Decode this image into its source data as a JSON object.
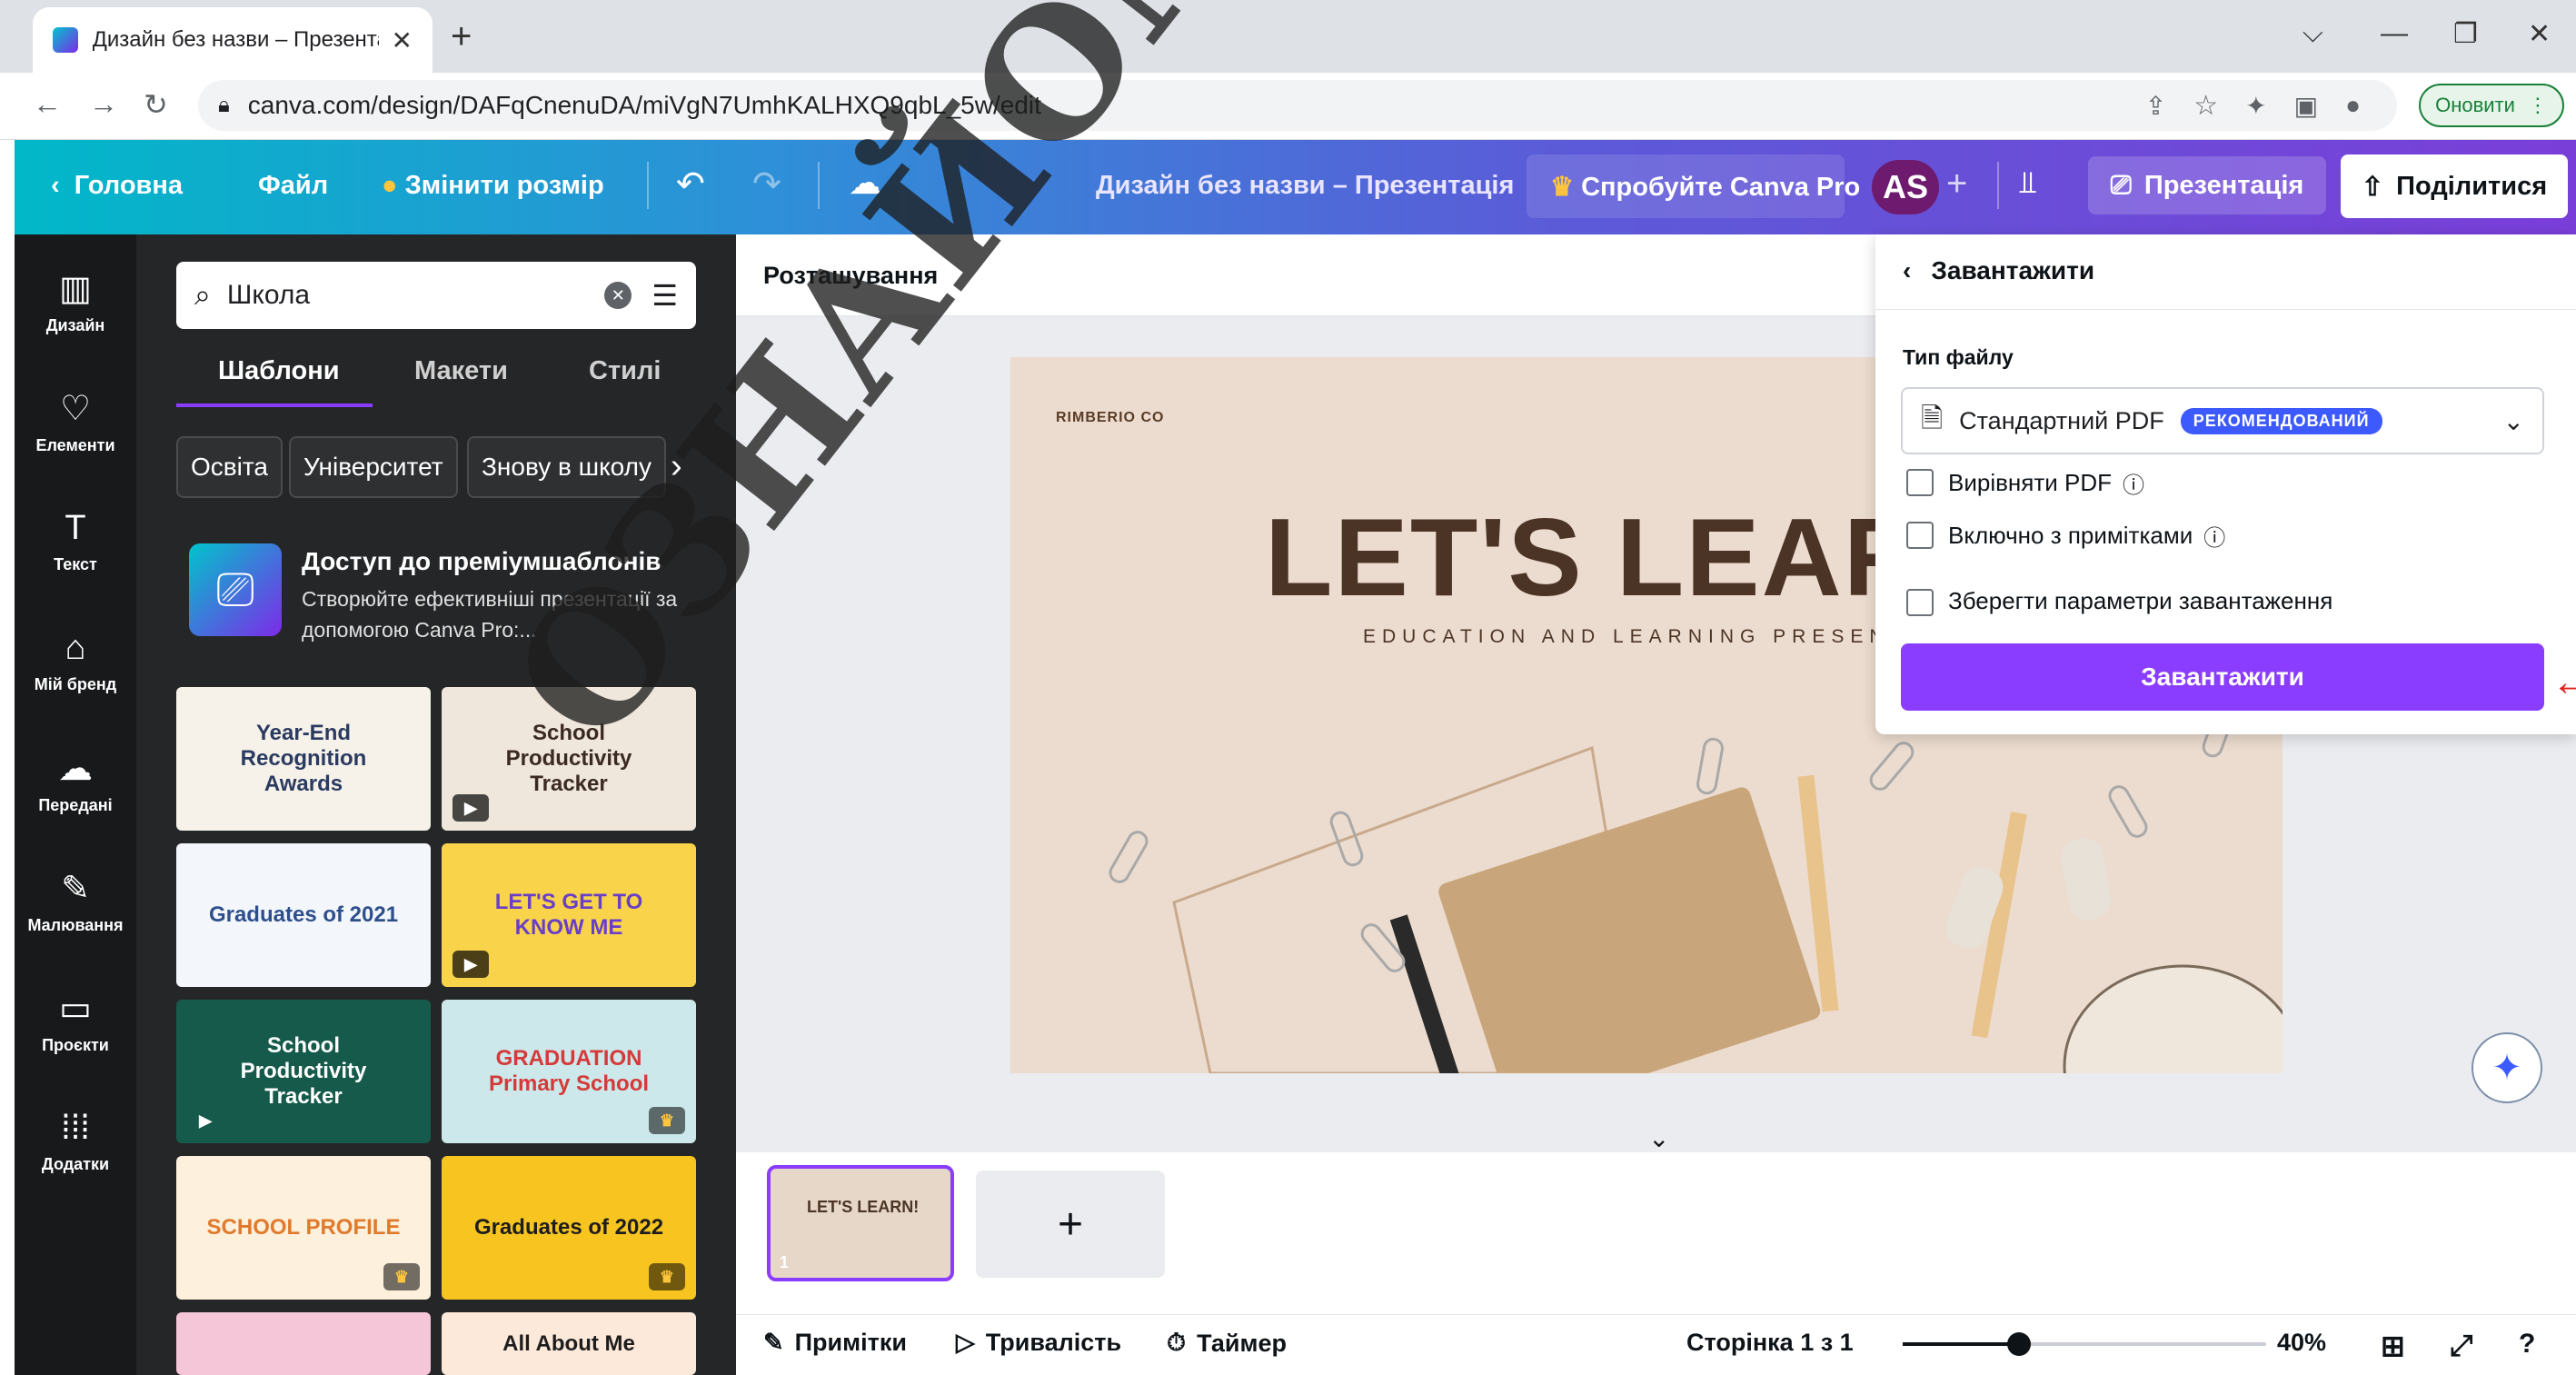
{
  "browser": {
    "tab_title": "Дизайн без назви – Презентаці",
    "tab_close": "✕",
    "new_tab": "+",
    "url": "canva.com/design/DAFqCnenuDA/miVgN7UmhKALHXQ9qbL_5w/edit",
    "update_label": "Оновити"
  },
  "header": {
    "home": "Головна",
    "file": "Файл",
    "resize": "Змінити розмір",
    "doc_title": "Дизайн без назви – Презентація",
    "try_pro": "Спробуйте Canva Pro",
    "avatar": "AS",
    "present": "Презентація",
    "share": "Поділитися"
  },
  "rail": {
    "items": [
      {
        "label": "Дизайн",
        "icon": "▥"
      },
      {
        "label": "Елементи",
        "icon": "♡"
      },
      {
        "label": "Текст",
        "icon": "T"
      },
      {
        "label": "Мій бренд",
        "icon": "⌂"
      },
      {
        "label": "Передані",
        "icon": "☁"
      },
      {
        "label": "Малювання",
        "icon": "✎"
      },
      {
        "label": "Проєкти",
        "icon": "▭"
      },
      {
        "label": "Додатки",
        "icon": "⁞⁞⁞"
      }
    ]
  },
  "panel": {
    "search_value": "Школа",
    "tabs": [
      "Шаблони",
      "Макети",
      "Стилі"
    ],
    "chips": [
      "Освіта",
      "Університет",
      "Знову в школу"
    ],
    "promo_title": "Доступ до преміумшаблонів",
    "promo_desc": "Створюйте ефективніші презентації за допомогою Canva Pro:...",
    "templates": [
      {
        "text": "Year-End Recognition Awards",
        "bg": "#f6f2ea",
        "fg": "#2a3a60"
      },
      {
        "text": "School Productivity Tracker",
        "bg": "#efe6dc",
        "fg": "#3a2a20"
      },
      {
        "text": "Graduates of 2021",
        "bg": "#f3f7fb",
        "fg": "#2e4f8c"
      },
      {
        "text": "LET'S GET TO KNOW ME",
        "bg": "#f9d44a",
        "fg": "#6a3fc8"
      },
      {
        "text": "School Productivity Tracker",
        "bg": "#155a4a",
        "fg": "#ffffff"
      },
      {
        "text": "GRADUATION Primary School",
        "bg": "#cde8ea",
        "fg": "#d53a3a"
      },
      {
        "text": "SCHOOL PROFILE",
        "bg": "#fdf0dc",
        "fg": "#e07a2c"
      },
      {
        "text": "Graduates of 2022",
        "bg": "#f8c520",
        "fg": "#1d1d1d"
      },
      {
        "text": "",
        "bg": "#f5c6d8",
        "fg": "#1d1d1d"
      },
      {
        "text": "All About Me",
        "bg": "#fde9d9",
        "fg": "#1d1d1d"
      }
    ]
  },
  "canvas": {
    "layout_label": "Розташування",
    "slide_brand": "RIMBERIO CO",
    "slide_title": "LET'S LEARN",
    "slide_subtitle": "EDUCATION AND LEARNING PRESENTATION",
    "page_thumb_title": "LET'S LEARN!",
    "page_number": "1"
  },
  "download": {
    "title": "Завантажити",
    "file_type_label": "Тип файлу",
    "file_type_value": "Стандартний PDF",
    "badge": "РЕКОМЕНДОВАНИЙ",
    "opt_flatten": "Вирівняти PDF",
    "opt_notes": "Включно з примітками",
    "opt_save": "Зберегти параметри завантаження",
    "button": "Завантажити"
  },
  "bottom": {
    "notes": "Примітки",
    "duration": "Тривалість",
    "timer": "Таймер",
    "page_info": "Сторінка 1 з 1",
    "zoom": "40%",
    "zoom_fraction": 0.32
  },
  "watermark": "ОЗНАЙОМЛЕНЕ",
  "colors": {
    "accent": "#8b3dff",
    "badge": "#3d5afe",
    "rail": "#18191b",
    "panel": "#252627"
  }
}
